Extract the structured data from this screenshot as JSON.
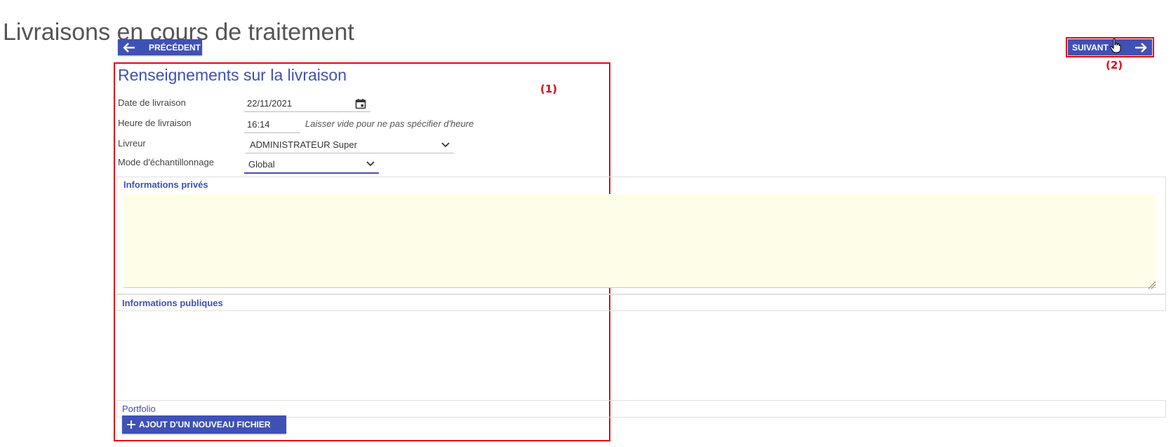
{
  "page": {
    "title": "Livraisons en cours de traitement"
  },
  "nav": {
    "prev_label": "PRÉCÉDENT",
    "next_label": "SUIVANT"
  },
  "annotations": {
    "marker_1": "(1)",
    "marker_2": "(2)"
  },
  "form": {
    "title": "Renseignements sur la livraison",
    "date": {
      "label": "Date de livraison",
      "value": "22/11/2021"
    },
    "time": {
      "label": "Heure de livraison",
      "value": "16:14",
      "hint": "Laisser vide pour ne pas spécifier d'heure"
    },
    "livreur": {
      "label": "Livreur",
      "value": "ADMINISTRATEUR Super"
    },
    "mode": {
      "label": "Mode d'échantillonnage",
      "value": "Global"
    }
  },
  "panels": {
    "prives": {
      "label": "Informations privés",
      "value": ""
    },
    "publiques": {
      "label": "Informations publiques"
    },
    "portfolio": {
      "label": "Portfolio",
      "add_button": "AJOUT D'UN NOUVEAU FICHIER"
    }
  },
  "colors": {
    "primary": "#3f51b5",
    "highlight": "#e30613",
    "textarea_bg": "#fefee8"
  },
  "icons": [
    "arrow-left-icon",
    "arrow-right-icon",
    "calendar-icon",
    "chevron-down-icon",
    "plus-icon",
    "hand-cursor-icon",
    "resize-grip-icon"
  ]
}
